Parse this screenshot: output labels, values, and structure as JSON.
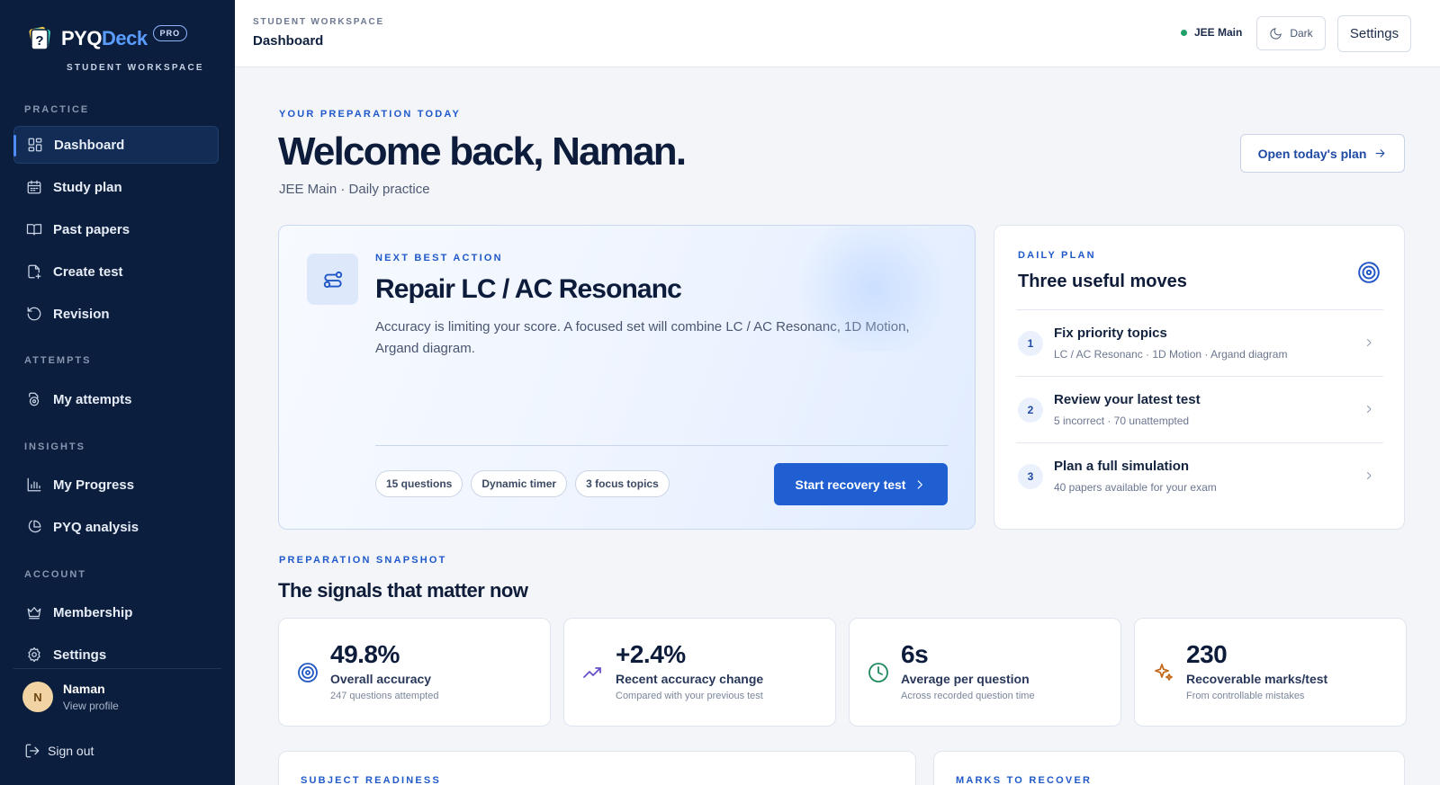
{
  "brand": {
    "name_part1": "PYQ",
    "name_part2": "Deck",
    "badge": "PRO",
    "subtitle": "STUDENT WORKSPACE"
  },
  "sidebar": {
    "sections": {
      "practice": "PRACTICE",
      "attempts": "ATTEMPTS",
      "insights": "INSIGHTS",
      "account": "ACCOUNT"
    },
    "items": [
      {
        "label": "Dashboard",
        "icon": "grid-icon",
        "active": true
      },
      {
        "label": "Study plan",
        "icon": "calendar-icon"
      },
      {
        "label": "Past papers",
        "icon": "book-icon"
      },
      {
        "label": "Create test",
        "icon": "file-plus-icon"
      },
      {
        "label": "Revision",
        "icon": "rotate-icon"
      },
      {
        "label": "My attempts",
        "icon": "attempts-icon"
      },
      {
        "label": "My Progress",
        "icon": "bar-chart-icon"
      },
      {
        "label": "PYQ analysis",
        "icon": "pie-chart-icon"
      },
      {
        "label": "Membership",
        "icon": "crown-icon"
      },
      {
        "label": "Settings",
        "icon": "gear-icon"
      }
    ],
    "profile": {
      "initial": "N",
      "name": "Naman",
      "link": "View profile"
    },
    "signout": "Sign out"
  },
  "topbar": {
    "crumb": "STUDENT WORKSPACE",
    "title": "Dashboard",
    "exam": "JEE Main",
    "theme_label": "Dark",
    "settings_label": "Settings"
  },
  "hero": {
    "eyebrow": "YOUR PREPARATION TODAY",
    "title": "Welcome back, Naman.",
    "subtitle": "JEE Main · Daily practice",
    "plan_button": "Open today's plan"
  },
  "next_action": {
    "eyebrow": "NEXT BEST ACTION",
    "title": "Repair LC / AC Resonanc",
    "description": "Accuracy is limiting your score. A focused set will combine LC / AC Resonanc, 1D Motion, Argand diagram.",
    "chips": [
      "15 questions",
      "Dynamic timer",
      "3 focus topics"
    ],
    "cta": "Start recovery test"
  },
  "daily_plan": {
    "eyebrow": "DAILY PLAN",
    "title": "Three useful moves",
    "items": [
      {
        "num": "1",
        "title": "Fix priority topics",
        "sub": "LC / AC Resonanc · 1D Motion · Argand diagram"
      },
      {
        "num": "2",
        "title": "Review your latest test",
        "sub": "5 incorrect · 70 unattempted"
      },
      {
        "num": "3",
        "title": "Plan a full simulation",
        "sub": "40 papers available for your exam"
      }
    ]
  },
  "snapshot": {
    "eyebrow": "PREPARATION SNAPSHOT",
    "title": "The signals that matter now",
    "stats": [
      {
        "value": "49.8%",
        "label": "Overall accuracy",
        "sub": "247 questions attempted",
        "icon": "target-icon",
        "color": "#2157c4"
      },
      {
        "value": "+2.4%",
        "label": "Recent accuracy change",
        "sub": "Compared with your previous test",
        "icon": "trend-up-icon",
        "color": "#6a4fc9"
      },
      {
        "value": "6s",
        "label": "Average per question",
        "sub": "Across recorded question time",
        "icon": "clock-icon",
        "color": "#1f8a5b"
      },
      {
        "value": "230",
        "label": "Recoverable marks/test",
        "sub": "From controllable mistakes",
        "icon": "sparkle-icon",
        "color": "#c46a1d"
      }
    ]
  },
  "bottom": {
    "subject_readiness": "SUBJECT READINESS",
    "marks_to_recover": "MARKS TO RECOVER"
  }
}
